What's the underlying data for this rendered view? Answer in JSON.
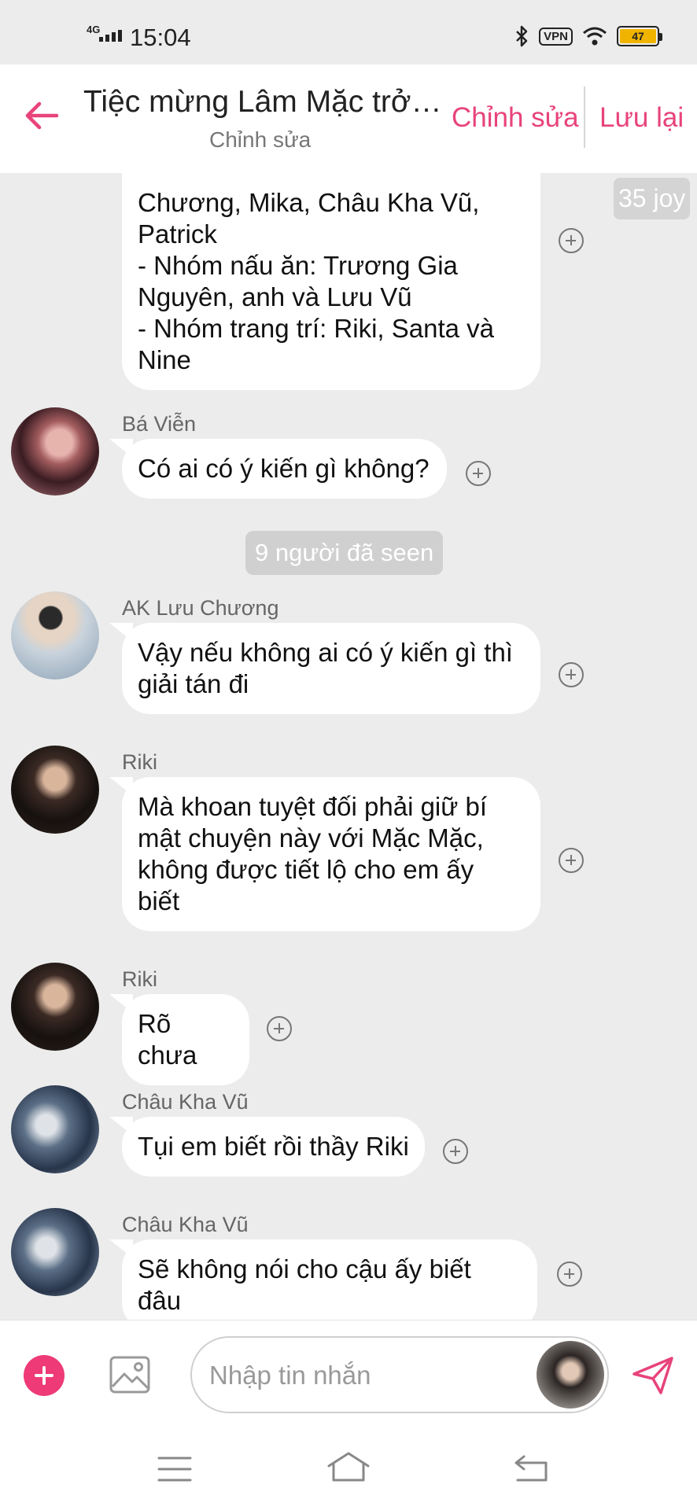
{
  "status_bar": {
    "network": "4G",
    "time": "15:04",
    "vpn": "VPN",
    "battery": "47"
  },
  "header": {
    "title": "Tiệc mừng Lâm Mặc trở …",
    "subtitle": "Chỉnh sửa",
    "edit_label": "Chỉnh sửa",
    "save_label": "Lưu lại"
  },
  "messages": [
    {
      "lines": [
        "Chương, Mika, Châu Kha Vũ,",
        "Patrick",
        "- Nhóm nấu ăn: Trương Gia",
        "Nguyên, anh và Lưu Vũ",
        "- Nhóm trang trí: Riki, Santa và",
        "Nine"
      ],
      "joy_badge": "35 joy"
    },
    {
      "sender": "Bá Viễn",
      "lines": [
        "Có ai có ý kiến gì không?"
      ]
    },
    {
      "sender": "AK Lưu Chương",
      "lines": [
        "Vậy nếu không ai có ý kiến gì thì",
        "giải tán đi"
      ]
    },
    {
      "sender": "Riki",
      "lines": [
        "Mà khoan tuyệt đối phải giữ bí",
        "mật chuyện này với Mặc Mặc,",
        "không được tiết lộ cho em ấy",
        "biết"
      ]
    },
    {
      "sender": "Riki",
      "lines": [
        "Rõ chưa"
      ]
    },
    {
      "sender": "Châu Kha Vũ",
      "lines": [
        "Tụi em biết rồi thầy Riki"
      ]
    },
    {
      "sender": "Châu Kha Vũ",
      "lines": [
        "Sẽ không nói cho cậu ấy biết đâu"
      ]
    }
  ],
  "seen_notice": "9 người đã seen",
  "composer": {
    "placeholder": "Nhập tin nhắn"
  },
  "icons": {
    "back": "arrow-left-icon",
    "add": "plus-icon",
    "image": "image-icon",
    "send": "send-icon",
    "reaction": "plus-circle-icon",
    "nav_menu": "menu-icon",
    "nav_home": "home-icon",
    "nav_back": "back-icon"
  },
  "colors": {
    "accent": "#e8437b",
    "background": "#ececec",
    "bubble": "#ffffff"
  }
}
